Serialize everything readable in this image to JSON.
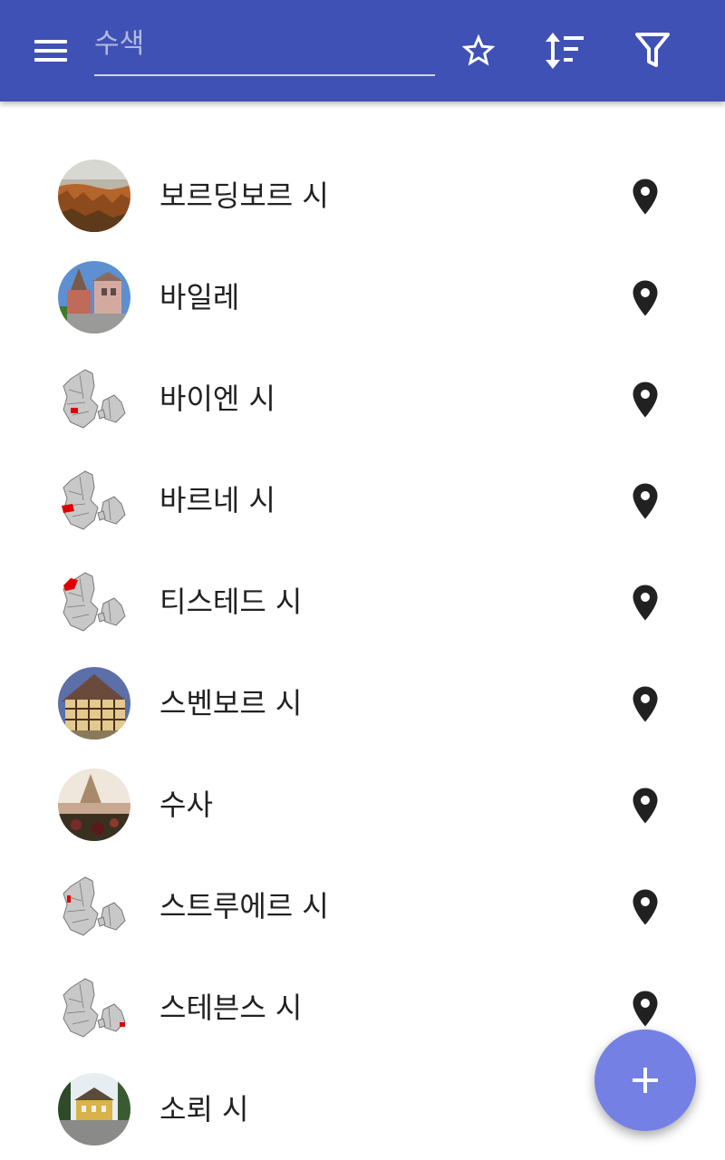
{
  "toolbar": {
    "menu_icon": "menu-icon",
    "search_placeholder": "수색",
    "search_value": "",
    "favorites_icon": "star-outline-icon",
    "sort_icon": "sort-icon",
    "filter_icon": "filter-icon",
    "color": "#3f51b5"
  },
  "items": [
    {
      "name": "보르딩보르 시",
      "thumb": "photo-cliffs"
    },
    {
      "name": "바일레",
      "thumb": "photo-building"
    },
    {
      "name": "바이엔 시",
      "thumb": "map-denmark"
    },
    {
      "name": "바르네 시",
      "thumb": "map-denmark"
    },
    {
      "name": "티스테드 시",
      "thumb": "map-denmark"
    },
    {
      "name": "스벤보르 시",
      "thumb": "photo-timber-house"
    },
    {
      "name": "수사",
      "thumb": "photo-ruins"
    },
    {
      "name": "스트루에르 시",
      "thumb": "map-denmark"
    },
    {
      "name": "스테븐스 시",
      "thumb": "map-denmark"
    },
    {
      "name": "소뢰 시",
      "thumb": "photo-yellow-house"
    }
  ],
  "fab": {
    "icon": "add-icon",
    "color": "#7480e4"
  }
}
